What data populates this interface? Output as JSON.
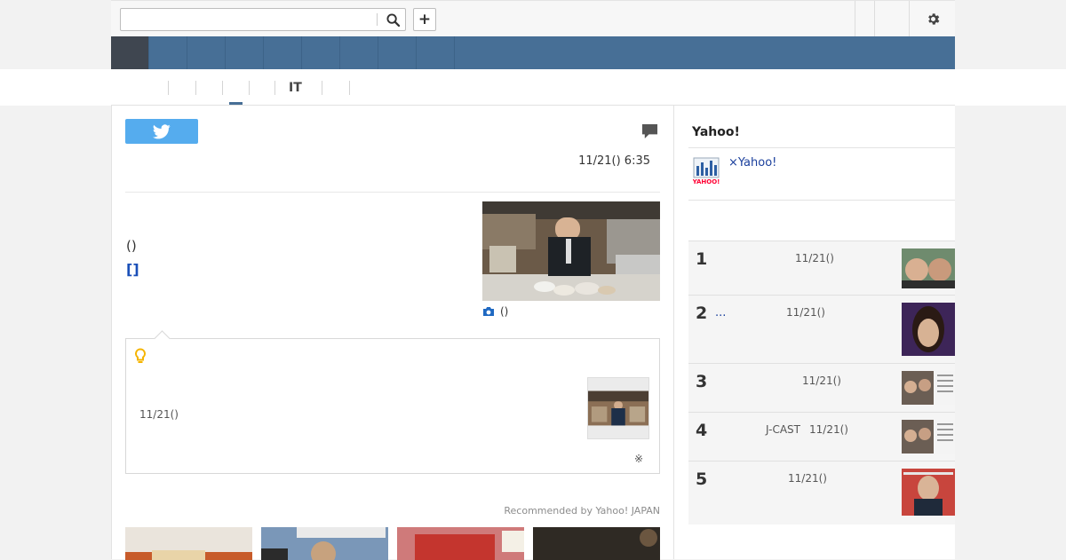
{
  "header": {
    "search": {
      "value": "",
      "placeholder": ""
    },
    "add_label": "+"
  },
  "nav": {
    "items": [
      "",
      "",
      "",
      "",
      "",
      "",
      "",
      "",
      ""
    ],
    "active_index": 0
  },
  "subnav": {
    "items": [
      "",
      "",
      "",
      "",
      "",
      "IT",
      ""
    ],
    "active_index": 3
  },
  "article": {
    "date": "11/21() 6:35",
    "paren_text": "()",
    "bracket_link": "[]",
    "photo_caption": "()"
  },
  "tip": {
    "date": "11/21()",
    "note": "※"
  },
  "recommend": {
    "label": "Recommended by Yahoo! JAPAN"
  },
  "sidebar": {
    "title": "Yahoo!",
    "link": "×Yahoo!",
    "logo_text": "YAHOO!",
    "ranking": [
      {
        "rank": "1",
        "source": "",
        "date": "11/21()"
      },
      {
        "rank": "2",
        "ellipsis": "...",
        "source": "",
        "date": "11/21()"
      },
      {
        "rank": "3",
        "source": "",
        "date": "11/21()"
      },
      {
        "rank": "4",
        "source": "J-CAST",
        "date": "11/21()"
      },
      {
        "rank": "5",
        "source": "",
        "date": "11/21()"
      }
    ]
  },
  "colors": {
    "nav_bar": "#476f96",
    "nav_active": "#3f4650",
    "twitter": "#55acee",
    "link": "#1a3f9c",
    "tip_bulb": "#f5b400"
  }
}
